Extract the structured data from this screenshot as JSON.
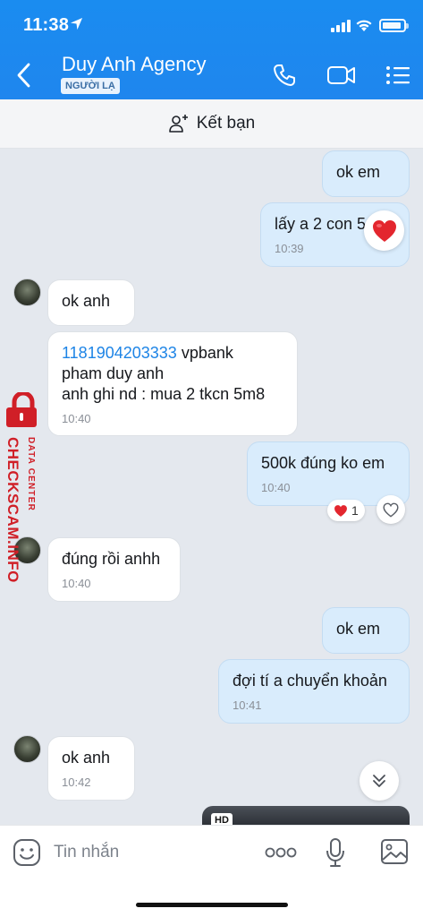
{
  "status_bar": {
    "time": "11:38"
  },
  "header": {
    "title": "Duy Anh Agency",
    "badge": "NGƯỜI LẠ"
  },
  "friend_bar": {
    "label": "Kết bạn"
  },
  "messages": [
    {
      "side": "out",
      "text": "ok em"
    },
    {
      "side": "out",
      "text": "lấy a 2 con 5",
      "time": "10:39",
      "reaction": "heart"
    },
    {
      "side": "in",
      "text": "ok anh"
    },
    {
      "side": "in",
      "account": "1181904203333",
      "text_after_account": " vpbank",
      "line2": "pham duy anh",
      "line3": "anh ghi nd : mua 2 tkcn 5m8",
      "time": "10:40"
    },
    {
      "side": "out",
      "text": "500k đúng ko em",
      "time": "10:40",
      "reaction_count": "1"
    },
    {
      "side": "in",
      "text": "đúng rồi anhh",
      "time": "10:40"
    },
    {
      "side": "out",
      "text": "ok em"
    },
    {
      "side": "out",
      "text": "đợi tí a chuyển khoản",
      "time": "10:41"
    },
    {
      "side": "in",
      "text": "ok anh",
      "time": "10:42"
    }
  ],
  "media_preview": {
    "badge": "HD"
  },
  "watermark": {
    "line1": "CHECKSCAM.INFO",
    "line2": "DATA CENTER"
  },
  "input": {
    "placeholder": "Tin nhắn"
  },
  "colors": {
    "header": "#1a8cf0",
    "outgoing_bubble": "#d9ecfc",
    "incoming_bubble": "#ffffff",
    "link": "#1d84e6",
    "watermark": "#d01f27"
  }
}
